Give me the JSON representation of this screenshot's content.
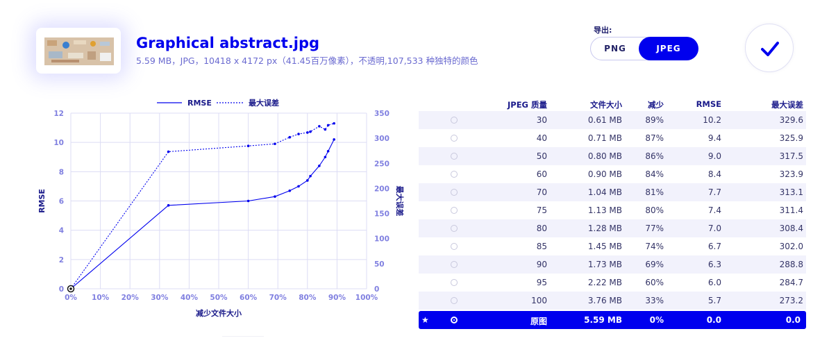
{
  "file": {
    "name": "Graphical abstract.jpg",
    "meta": "5.59 MB，JPG，10418 x 4172 px（41.45百万像素），不透明,107,533 种独特的颜色"
  },
  "export": {
    "label": "导出:",
    "options": [
      "PNG",
      "JPEG"
    ],
    "selected": "JPEG"
  },
  "confirm_icon": "checkmark-icon",
  "colors": {
    "accent": "#0000ee",
    "grid": "#dcdcf4",
    "row_alt": "#f2f2fc"
  },
  "chart_data": {
    "type": "line",
    "xlabel": "减少文件大小",
    "ylabel": "RMSE",
    "y2label": "最大误差",
    "xlim": [
      0,
      100
    ],
    "ylim": [
      0,
      12
    ],
    "y2lim": [
      0,
      350
    ],
    "x_ticks": [
      "0%",
      "10%",
      "20%",
      "30%",
      "40%",
      "50%",
      "60%",
      "70%",
      "80%",
      "90%",
      "100%"
    ],
    "y_ticks": [
      "0",
      "2",
      "4",
      "6",
      "8",
      "10",
      "12"
    ],
    "y2_ticks": [
      "0",
      "50",
      "100",
      "150",
      "200",
      "250",
      "300",
      "350"
    ],
    "legend": {
      "position": "top-center",
      "entries": [
        "RMSE",
        "最大误差"
      ]
    },
    "series": [
      {
        "name": "RMSE",
        "style": "solid",
        "axis": "left",
        "x": [
          0,
          33,
          60,
          69,
          74,
          77,
          80,
          81,
          84,
          86,
          87,
          89
        ],
        "y": [
          0,
          5.7,
          6.0,
          6.3,
          6.7,
          7.0,
          7.4,
          7.7,
          8.4,
          9.0,
          9.4,
          10.2
        ]
      },
      {
        "name": "最大误差",
        "style": "dotted",
        "axis": "right",
        "x": [
          0,
          33,
          60,
          69,
          74,
          77,
          80,
          81,
          84,
          86,
          87,
          89
        ],
        "y": [
          0,
          273.2,
          284.7,
          288.8,
          302.0,
          308.4,
          311.4,
          313.1,
          323.9,
          317.5,
          325.9,
          329.6
        ]
      }
    ]
  },
  "table": {
    "headers": [
      "JPEG 质量",
      "文件大小",
      "减少",
      "RMSE",
      "最大误差"
    ],
    "rows": [
      {
        "quality": "30",
        "size": "0.61 MB",
        "reduction": "89%",
        "rmse": "10.2",
        "max_error": "329.6"
      },
      {
        "quality": "40",
        "size": "0.71 MB",
        "reduction": "87%",
        "rmse": "9.4",
        "max_error": "325.9"
      },
      {
        "quality": "50",
        "size": "0.80 MB",
        "reduction": "86%",
        "rmse": "9.0",
        "max_error": "317.5"
      },
      {
        "quality": "60",
        "size": "0.90 MB",
        "reduction": "84%",
        "rmse": "8.4",
        "max_error": "323.9"
      },
      {
        "quality": "70",
        "size": "1.04 MB",
        "reduction": "81%",
        "rmse": "7.7",
        "max_error": "313.1"
      },
      {
        "quality": "75",
        "size": "1.13 MB",
        "reduction": "80%",
        "rmse": "7.4",
        "max_error": "311.4"
      },
      {
        "quality": "80",
        "size": "1.28 MB",
        "reduction": "77%",
        "rmse": "7.0",
        "max_error": "308.4"
      },
      {
        "quality": "85",
        "size": "1.45 MB",
        "reduction": "74%",
        "rmse": "6.7",
        "max_error": "302.0"
      },
      {
        "quality": "90",
        "size": "1.73 MB",
        "reduction": "69%",
        "rmse": "6.3",
        "max_error": "288.8"
      },
      {
        "quality": "95",
        "size": "2.22 MB",
        "reduction": "60%",
        "rmse": "6.0",
        "max_error": "284.7"
      },
      {
        "quality": "100",
        "size": "3.76 MB",
        "reduction": "33%",
        "rmse": "5.7",
        "max_error": "273.2"
      }
    ],
    "original": {
      "star": "★",
      "quality": "原图",
      "size": "5.59 MB",
      "reduction": "0%",
      "rmse": "0.0",
      "max_error": "0.0"
    }
  }
}
